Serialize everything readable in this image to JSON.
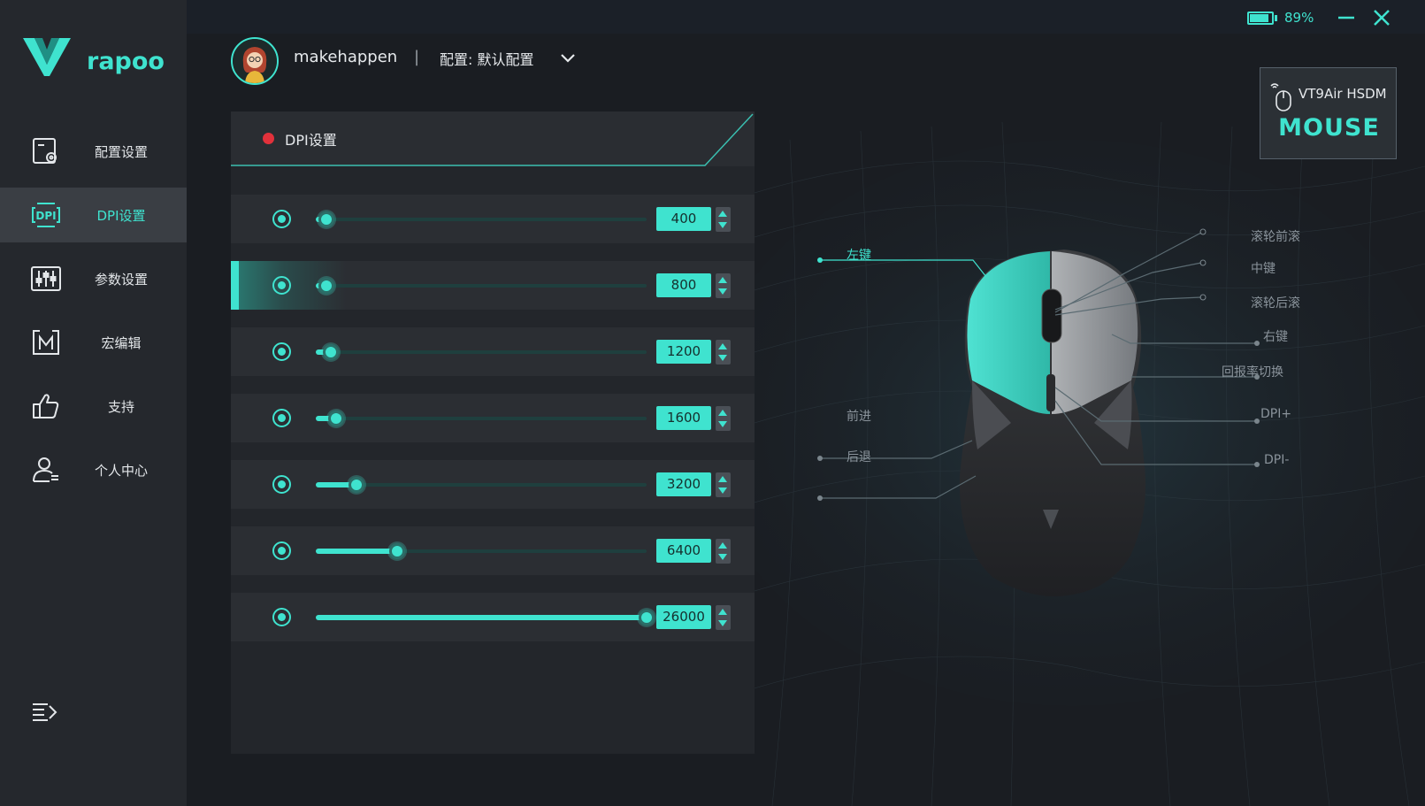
{
  "brand": {
    "logo_text": "rapoo"
  },
  "colors": {
    "accent": "#3fe3cf",
    "record_dot": "#e2313b",
    "sidebar_bg": "#25282d",
    "page_bg": "#1a1d22"
  },
  "sidebar": {
    "items": [
      {
        "label": "配置设置",
        "icon": "profile-settings-icon",
        "active": false
      },
      {
        "label": "DPI设置",
        "icon": "dpi-icon",
        "active": true
      },
      {
        "label": "参数设置",
        "icon": "sliders-icon",
        "active": false
      },
      {
        "label": "宏编辑",
        "icon": "macro-icon",
        "active": false
      },
      {
        "label": "支持",
        "icon": "thumbs-up-icon",
        "active": false
      },
      {
        "label": "个人中心",
        "icon": "user-icon",
        "active": false
      }
    ],
    "collapse_icon": "menu-collapse-icon"
  },
  "topbar": {
    "battery_percent": "89%",
    "battery_level": 0.89
  },
  "profile": {
    "username": "makehappen",
    "separator": "|",
    "config_label": "配置: 默认配置"
  },
  "dpi_panel": {
    "title": "DPI设置",
    "slider_max": 26000,
    "rows": [
      {
        "value": "400",
        "level": 400,
        "selected": false
      },
      {
        "value": "800",
        "level": 800,
        "selected": true
      },
      {
        "value": "1200",
        "level": 1200,
        "selected": false
      },
      {
        "value": "1600",
        "level": 1600,
        "selected": false
      },
      {
        "value": "3200",
        "level": 3200,
        "selected": false
      },
      {
        "value": "6400",
        "level": 6400,
        "selected": false
      },
      {
        "value": "26000",
        "level": 26000,
        "selected": false
      }
    ]
  },
  "device": {
    "name": "VT9Air HSDM",
    "type": "MOUSE",
    "labels": {
      "left_click": "左键",
      "forward": "前进",
      "back": "后退",
      "scroll_up": "滚轮前滚",
      "middle": "中键",
      "scroll_down": "滚轮后滚",
      "right_click": "右键",
      "polling_switch": "回报率切换",
      "dpi_plus": "DPI+",
      "dpi_minus": "DPI-"
    }
  }
}
